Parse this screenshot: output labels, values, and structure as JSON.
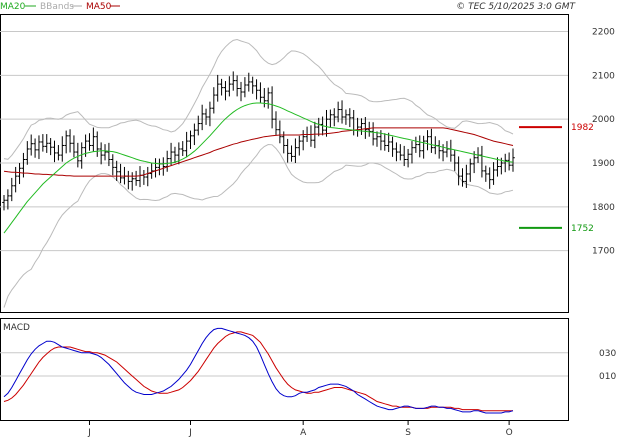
{
  "header": {
    "legend": [
      {
        "label": "MA20",
        "color": "#22aa22"
      },
      {
        "label": "BBands",
        "color": "#aaaaaa"
      },
      {
        "label": "MA50",
        "color": "#aa0000"
      }
    ],
    "copyright": "© TEC 5/10/2025 3:0 GMT"
  },
  "colors": {
    "price": "#000000",
    "ma20": "#22bb22",
    "ma50": "#aa0000",
    "bbands": "#bbbbbb",
    "resistance": "#cc0000",
    "support": "#119911",
    "macd": "#0000cc",
    "signal": "#cc0000",
    "grid": "#c8c8c8"
  },
  "chart_data": [
    {
      "type": "ohlc",
      "panel": "price",
      "grid": true,
      "y_ticks": [
        "2200",
        "2100",
        "2000",
        "1900",
        "1800",
        "1700"
      ],
      "y_tick_values": [
        2200,
        2100,
        2000,
        1900,
        1800,
        1700
      ],
      "ylim": [
        1560,
        2240
      ],
      "x_ticks": [
        "J",
        "J",
        "A",
        "S",
        "O"
      ],
      "x_tick_index": [
        22,
        48,
        77,
        104,
        130
      ],
      "n_bars": 132,
      "levels": [
        {
          "name": "resistance",
          "value": 1982,
          "label": "1982"
        },
        {
          "name": "support",
          "value": 1752,
          "label": "1752"
        }
      ],
      "close": [
        1815,
        1825,
        1848,
        1870,
        1888,
        1908,
        1932,
        1944,
        1930,
        1948,
        1938,
        1945,
        1936,
        1923,
        1918,
        1940,
        1962,
        1945,
        1925,
        1905,
        1935,
        1950,
        1940,
        1960,
        1932,
        1918,
        1925,
        1908,
        1890,
        1880,
        1866,
        1870,
        1858,
        1864,
        1860,
        1872,
        1868,
        1876,
        1882,
        1890,
        1898,
        1892,
        1910,
        1925,
        1918,
        1932,
        1928,
        1950,
        1962,
        1975,
        1990,
        2012,
        2005,
        2025,
        2055,
        2080,
        2072,
        2064,
        2080,
        2088,
        2070,
        2062,
        2078,
        2085,
        2076,
        2066,
        2050,
        2042,
        2060,
        2000,
        1976,
        1960,
        1940,
        1922,
        1915,
        1935,
        1950,
        1960,
        1965,
        1952,
        1982,
        1988,
        1975,
        2000,
        2010,
        2005,
        2022,
        2005,
        2010,
        2003,
        1975,
        1982,
        1990,
        1976,
        1972,
        1955,
        1960,
        1950,
        1940,
        1948,
        1932,
        1925,
        1918,
        1908,
        1920,
        1935,
        1942,
        1928,
        1950,
        1960,
        1935,
        1940,
        1928,
        1925,
        1932,
        1918,
        1900,
        1870,
        1858,
        1875,
        1898,
        1912,
        1918,
        1882,
        1875,
        1862,
        1884,
        1892,
        1900,
        1906,
        1895,
        1912
      ],
      "ma20": [
        1740,
        1752,
        1764,
        1776,
        1788,
        1800,
        1812,
        1822,
        1832,
        1842,
        1852,
        1860,
        1868,
        1876,
        1884,
        1892,
        1900,
        1906,
        1911,
        1915,
        1919,
        1922,
        1924,
        1926,
        1927,
        1928,
        1928,
        1927,
        1926,
        1924,
        1921,
        1918,
        1915,
        1912,
        1909,
        1906,
        1904,
        1902,
        1900,
        1899,
        1898,
        1898,
        1899,
        1900,
        1902,
        1905,
        1909,
        1914,
        1920,
        1927,
        1935,
        1944,
        1953,
        1962,
        1972,
        1982,
        1992,
        2001,
        2009,
        2016,
        2022,
        2027,
        2031,
        2034,
        2036,
        2037,
        2037,
        2036,
        2035,
        2033,
        2030,
        2027,
        2023,
        2019,
        2015,
        2011,
        2007,
        2003,
        1999,
        1995,
        1991,
        1988,
        1985,
        1983,
        1981,
        1980,
        1979,
        1978,
        1977,
        1976,
        1975,
        1974,
        1973,
        1972,
        1971,
        1970,
        1969,
        1968,
        1966,
        1964,
        1962,
        1960,
        1958,
        1956,
        1954,
        1952,
        1950,
        1948,
        1946,
        1944,
        1942,
        1940,
        1938,
        1936,
        1934,
        1932,
        1930,
        1928,
        1926,
        1924,
        1922,
        1920,
        1918,
        1916,
        1914,
        1912,
        1910,
        1908,
        1906,
        1904,
        1903,
        1902
      ],
      "ma50": [
        1881,
        1880,
        1879,
        1879,
        1878,
        1877,
        1877,
        1876,
        1875,
        1875,
        1874,
        1874,
        1873,
        1873,
        1872,
        1872,
        1871,
        1871,
        1870,
        1870,
        1870,
        1870,
        1870,
        1870,
        1870,
        1870,
        1870,
        1870,
        1870,
        1870,
        1870,
        1870,
        1870,
        1870,
        1870,
        1871,
        1873,
        1876,
        1879,
        1882,
        1885,
        1888,
        1891,
        1894,
        1897,
        1900,
        1903,
        1906,
        1909,
        1912,
        1915,
        1918,
        1921,
        1924,
        1928,
        1931,
        1934,
        1937,
        1940,
        1943,
        1945,
        1948,
        1950,
        1952,
        1954,
        1956,
        1958,
        1960,
        1961,
        1962,
        1963,
        1964,
        1964,
        1964,
        1964,
        1964,
        1964,
        1965,
        1965,
        1965,
        1966,
        1966,
        1966,
        1967,
        1968,
        1969,
        1970,
        1972,
        1973,
        1974,
        1975,
        1976,
        1977,
        1978,
        1979,
        1980,
        1980,
        1980,
        1980,
        1980,
        1980,
        1980,
        1980,
        1980,
        1980,
        1980,
        1980,
        1980,
        1980,
        1980,
        1980,
        1980,
        1980,
        1980,
        1979,
        1977,
        1975,
        1973,
        1971,
        1969,
        1967,
        1965,
        1962,
        1959,
        1956,
        1953,
        1950,
        1948,
        1946,
        1944,
        1942,
        1940
      ]
    },
    {
      "type": "line",
      "panel": "macd",
      "title": "MACD",
      "grid": true,
      "y_ticks": [
        "030",
        "010"
      ],
      "y_tick_values": [
        30,
        10
      ],
      "ylim": [
        -28,
        60
      ],
      "series": [
        {
          "name": "MACD",
          "values": [
            -8,
            -5,
            0,
            6,
            12,
            18,
            24,
            29,
            33,
            36,
            38,
            40,
            40,
            39,
            37,
            35,
            34,
            33,
            32,
            31,
            30,
            30,
            30,
            29,
            28,
            26,
            23,
            20,
            16,
            12,
            8,
            4,
            1,
            -2,
            -4,
            -5,
            -6,
            -6,
            -6,
            -5,
            -4,
            -3,
            -1,
            1,
            4,
            7,
            11,
            15,
            20,
            26,
            32,
            38,
            43,
            47,
            50,
            51,
            51,
            50,
            49,
            48,
            47,
            46,
            45,
            43,
            40,
            35,
            28,
            20,
            12,
            5,
            -1,
            -5,
            -7,
            -8,
            -8,
            -7,
            -5,
            -4,
            -4,
            -3,
            -2,
            0,
            1,
            2,
            3,
            3,
            3,
            2,
            1,
            -1,
            -3,
            -6,
            -8,
            -10,
            -12,
            -14,
            -16,
            -17,
            -18,
            -19,
            -19,
            -18,
            -17,
            -16,
            -16,
            -17,
            -18,
            -18,
            -18,
            -17,
            -16,
            -16,
            -17,
            -17,
            -18,
            -18,
            -19,
            -20,
            -21,
            -21,
            -21,
            -20,
            -20,
            -21,
            -22,
            -22,
            -22,
            -22,
            -22,
            -21,
            -21,
            -20
          ]
        },
        {
          "name": "Signal",
          "values": [
            -12,
            -11,
            -9,
            -6,
            -2,
            2,
            7,
            12,
            17,
            22,
            26,
            29,
            32,
            34,
            35,
            35,
            35,
            35,
            34,
            33,
            32,
            31,
            31,
            30,
            30,
            29,
            28,
            26,
            24,
            22,
            19,
            16,
            13,
            10,
            7,
            4,
            1,
            -1,
            -3,
            -4,
            -5,
            -5,
            -5,
            -4,
            -3,
            -2,
            0,
            3,
            6,
            10,
            14,
            19,
            24,
            29,
            34,
            38,
            41,
            44,
            46,
            47,
            48,
            48,
            47,
            46,
            45,
            42,
            39,
            34,
            29,
            23,
            17,
            12,
            7,
            3,
            0,
            -2,
            -3,
            -4,
            -5,
            -5,
            -4,
            -4,
            -3,
            -2,
            -1,
            0,
            0,
            0,
            -1,
            -2,
            -3,
            -4,
            -5,
            -6,
            -8,
            -10,
            -12,
            -13,
            -14,
            -15,
            -16,
            -16,
            -17,
            -17,
            -17,
            -17,
            -18,
            -18,
            -18,
            -18,
            -17,
            -17,
            -17,
            -17,
            -17,
            -17,
            -18,
            -18,
            -19,
            -19,
            -19,
            -19,
            -19,
            -20,
            -20,
            -20,
            -20,
            -20,
            -20,
            -20,
            -20,
            -20
          ]
        }
      ]
    }
  ]
}
